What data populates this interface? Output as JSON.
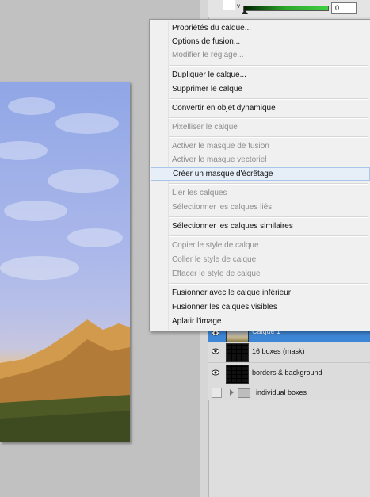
{
  "options_bar": {
    "v_label": "v",
    "value": "0"
  },
  "context_menu": {
    "items": [
      {
        "label": "Propriétés du calque...",
        "enabled": true
      },
      {
        "label": "Options de fusion...",
        "enabled": true
      },
      {
        "label": "Modifier le réglage...",
        "enabled": false
      },
      {
        "label": "Dupliquer le calque...",
        "enabled": true
      },
      {
        "label": "Supprimer le calque",
        "enabled": true
      },
      {
        "label": "Convertir en objet dynamique",
        "enabled": true
      },
      {
        "label": "Pixelliser le calque",
        "enabled": false
      },
      {
        "label": "Activer le masque de fusion",
        "enabled": false
      },
      {
        "label": "Activer le masque vectoriel",
        "enabled": false
      },
      {
        "label": "Créer un masque d'écrêtage",
        "enabled": true,
        "highlighted": true
      },
      {
        "label": "Lier les calques",
        "enabled": false
      },
      {
        "label": "Sélectionner les calques liés",
        "enabled": false
      },
      {
        "label": "Sélectionner les calques similaires",
        "enabled": true
      },
      {
        "label": "Copier le style de calque",
        "enabled": false
      },
      {
        "label": "Coller le style de calque",
        "enabled": false
      },
      {
        "label": "Effacer le style de calque",
        "enabled": false
      },
      {
        "label": "Fusionner avec le calque inférieur",
        "enabled": true
      },
      {
        "label": "Fusionner les calques visibles",
        "enabled": true
      },
      {
        "label": "Aplatir l'image",
        "enabled": true
      }
    ]
  },
  "layers": [
    {
      "name": "Calque 1",
      "selected": true
    },
    {
      "name": "16 boxes (mask)",
      "selected": false
    },
    {
      "name": "borders & background",
      "selected": false
    },
    {
      "name": "individual boxes",
      "type": "group"
    }
  ],
  "colors": {
    "selection": "#3d86d6",
    "menu_bg": "#f0f0f0",
    "menu_hover": "#e6eef8"
  }
}
